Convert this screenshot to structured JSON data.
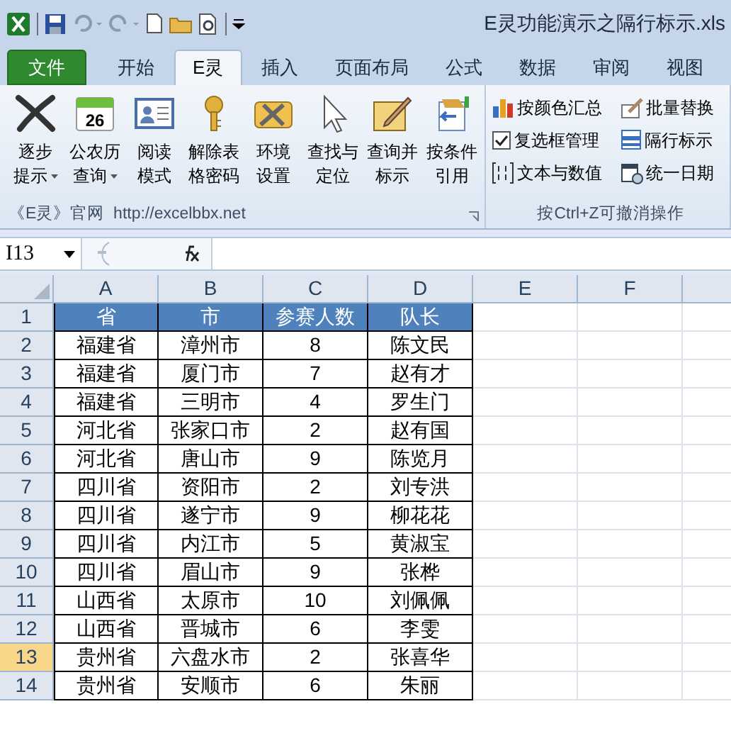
{
  "window": {
    "title": "E灵功能演示之隔行标示.xls"
  },
  "tabs": [
    {
      "label": "文件",
      "kind": "file",
      "selected": false
    },
    {
      "label": "开始",
      "kind": "tab",
      "selected": false
    },
    {
      "label": "E灵",
      "kind": "tab",
      "selected": true
    },
    {
      "label": "插入",
      "kind": "tab",
      "selected": false
    },
    {
      "label": "页面布局",
      "kind": "tab",
      "selected": false
    },
    {
      "label": "公式",
      "kind": "tab",
      "selected": false
    },
    {
      "label": "数据",
      "kind": "tab",
      "selected": false
    },
    {
      "label": "审阅",
      "kind": "tab",
      "selected": false
    },
    {
      "label": "视图",
      "kind": "tab",
      "selected": false
    }
  ],
  "ribbon": {
    "groups": [
      {
        "label": "《E灵》官网  http://excelbbx.net",
        "buttons": [
          {
            "lines": [
              "逐步",
              "提示"
            ],
            "dropdown": true
          },
          {
            "lines": [
              "公农历",
              "查询"
            ],
            "dropdown": true,
            "icon_text": "26"
          },
          {
            "lines": [
              "阅读",
              "模式"
            ],
            "dropdown": false
          },
          {
            "lines": [
              "解除表",
              "格密码"
            ],
            "dropdown": false
          },
          {
            "lines": [
              "环境",
              "设置"
            ],
            "dropdown": false
          },
          {
            "lines": [
              "查找与",
              "定位"
            ],
            "dropdown": false
          },
          {
            "lines": [
              "查询并",
              "标示"
            ],
            "dropdown": false
          },
          {
            "lines": [
              "按条件",
              "引用"
            ],
            "dropdown": false
          }
        ]
      },
      {
        "label": "按Ctrl+Z可撤消操作",
        "small_buttons": [
          "按颜色汇总",
          "批量替换",
          "复选框管理",
          "隔行标示",
          "文本与数值",
          "统一日期"
        ]
      }
    ]
  },
  "name_box": "I13",
  "columns": [
    "A",
    "B",
    "C",
    "D",
    "E",
    "F"
  ],
  "rows": [
    {
      "num": "1",
      "cells": [
        "省",
        "市",
        "参赛人数",
        "队长"
      ],
      "kind": "header",
      "selected": false
    },
    {
      "num": "2",
      "cells": [
        "福建省",
        "漳州市",
        "8",
        "陈文民"
      ],
      "kind": "data",
      "selected": false
    },
    {
      "num": "3",
      "cells": [
        "福建省",
        "厦门市",
        "7",
        "赵有才"
      ],
      "kind": "data",
      "selected": false
    },
    {
      "num": "4",
      "cells": [
        "福建省",
        "三明市",
        "4",
        "罗生门"
      ],
      "kind": "data",
      "selected": false
    },
    {
      "num": "5",
      "cells": [
        "河北省",
        "张家口市",
        "2",
        "赵有国"
      ],
      "kind": "data",
      "selected": false
    },
    {
      "num": "6",
      "cells": [
        "河北省",
        "唐山市",
        "9",
        "陈览月"
      ],
      "kind": "data",
      "selected": false
    },
    {
      "num": "7",
      "cells": [
        "四川省",
        "资阳市",
        "2",
        "刘专洪"
      ],
      "kind": "data",
      "selected": false
    },
    {
      "num": "8",
      "cells": [
        "四川省",
        "遂宁市",
        "9",
        "柳花花"
      ],
      "kind": "data",
      "selected": false
    },
    {
      "num": "9",
      "cells": [
        "四川省",
        "内江市",
        "5",
        "黄淑宝"
      ],
      "kind": "data",
      "selected": false
    },
    {
      "num": "10",
      "cells": [
        "四川省",
        "眉山市",
        "9",
        "张桦"
      ],
      "kind": "data",
      "selected": false
    },
    {
      "num": "11",
      "cells": [
        "山西省",
        "太原市",
        "10",
        "刘佩佩"
      ],
      "kind": "data",
      "selected": false
    },
    {
      "num": "12",
      "cells": [
        "山西省",
        "晋城市",
        "6",
        "李雯"
      ],
      "kind": "data",
      "selected": false
    },
    {
      "num": "13",
      "cells": [
        "贵州省",
        "六盘水市",
        "2",
        "张喜华"
      ],
      "kind": "data",
      "selected": true
    },
    {
      "num": "14",
      "cells": [
        "贵州省",
        "安顺市",
        "6",
        "朱丽"
      ],
      "kind": "data",
      "selected": false
    }
  ]
}
